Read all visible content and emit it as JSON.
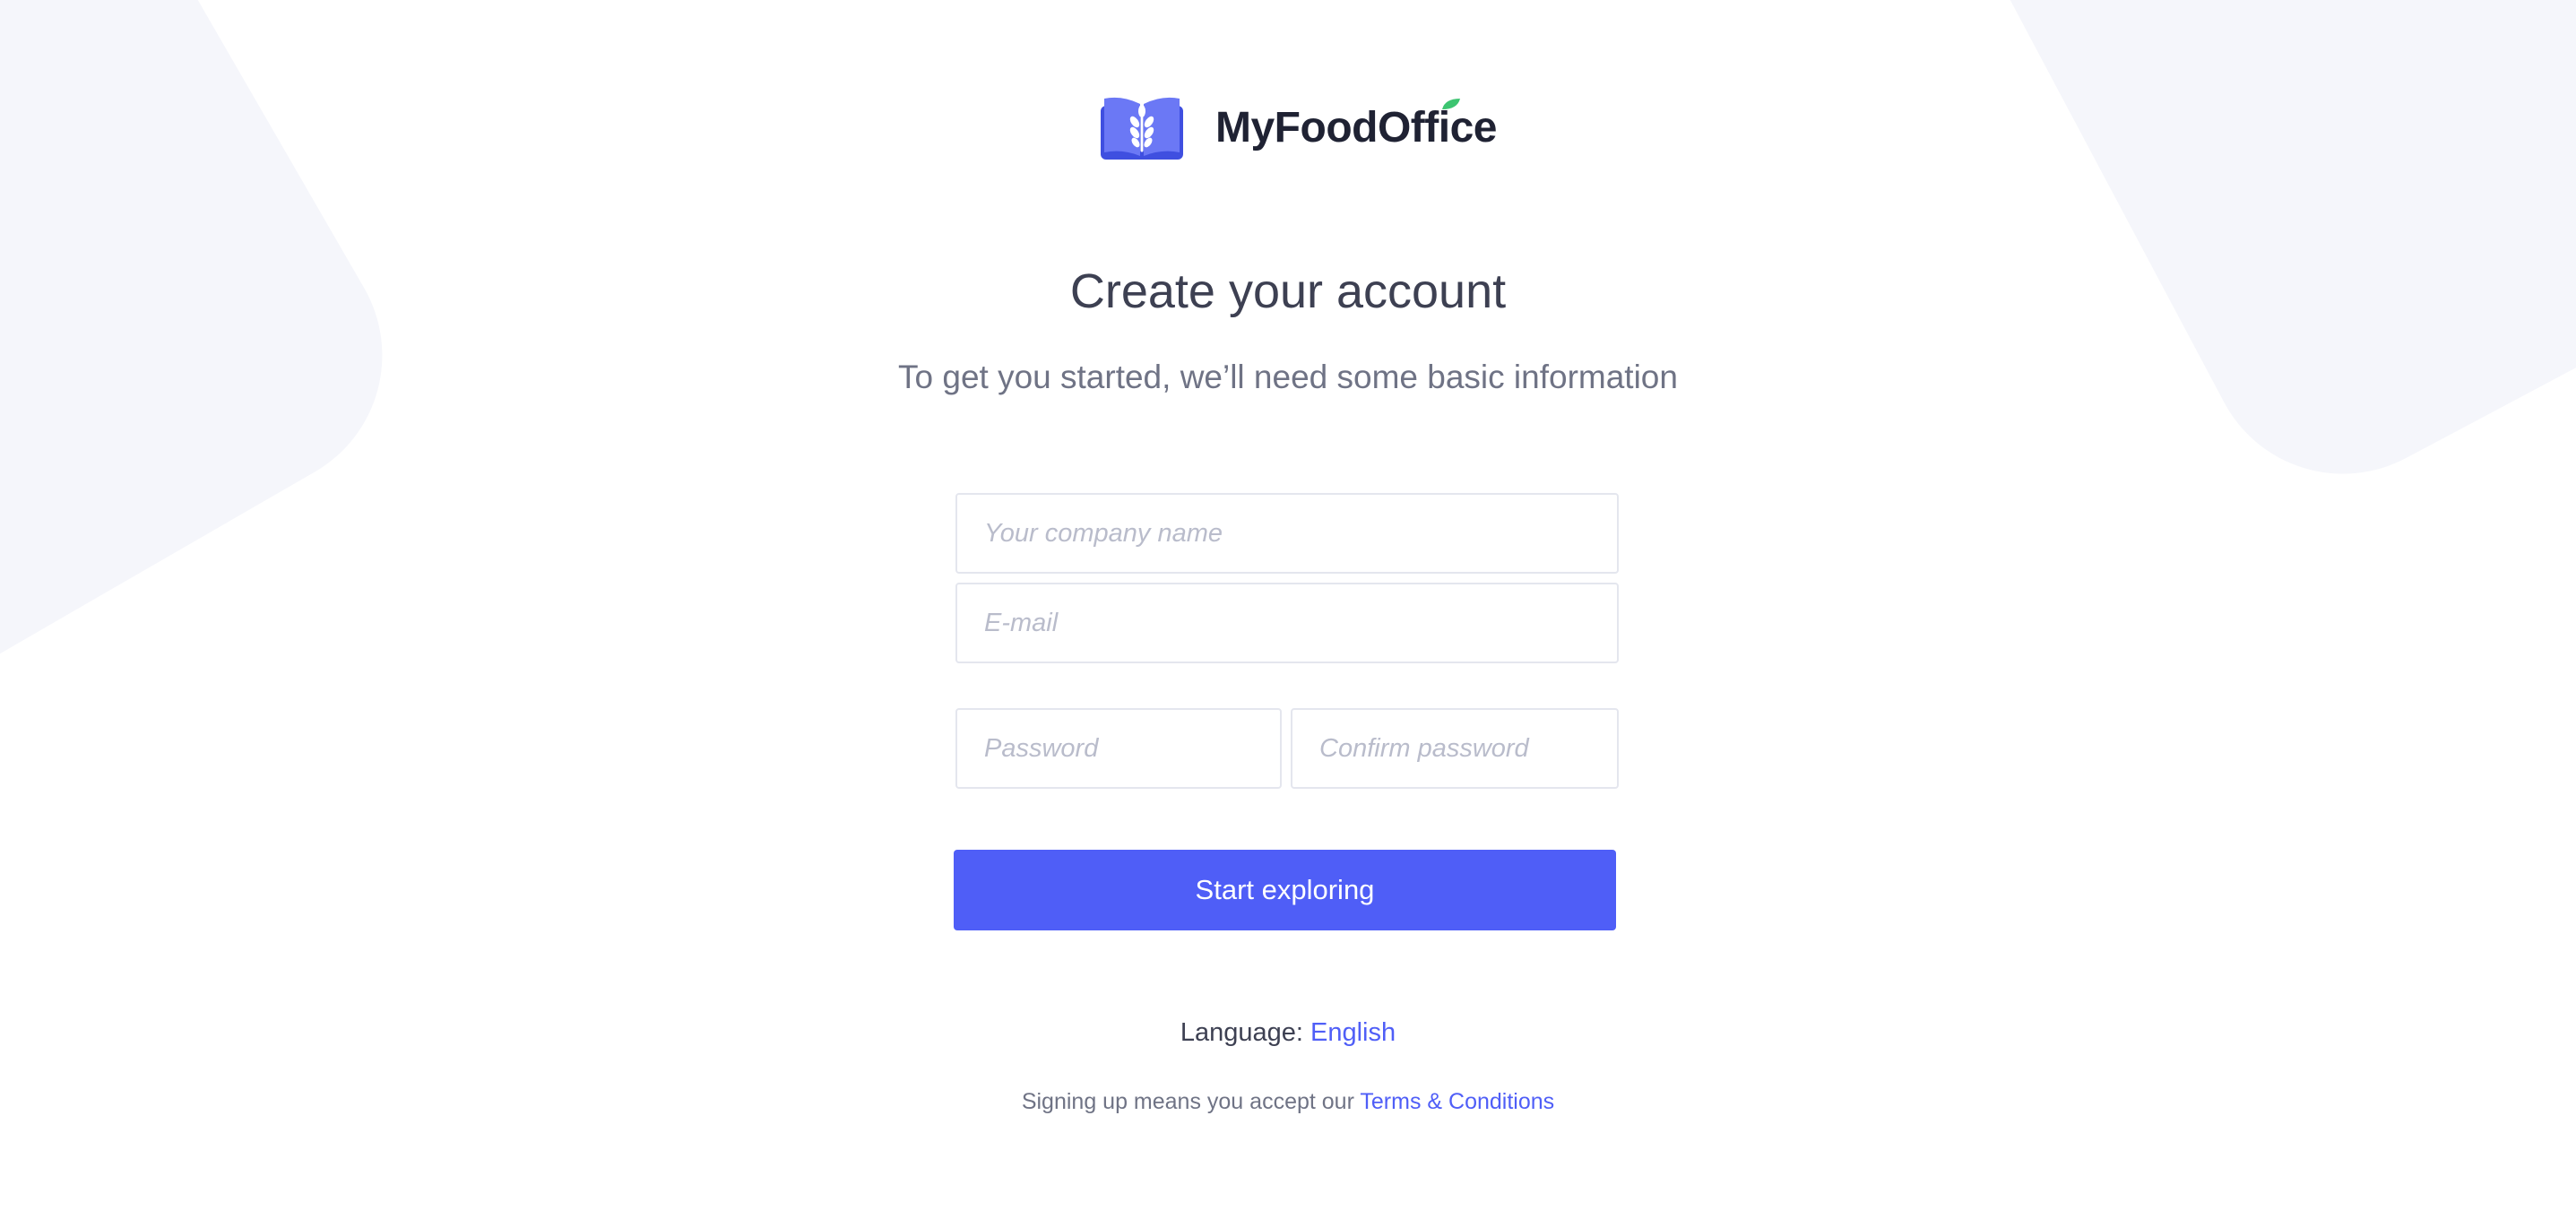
{
  "brand": {
    "name": "MyFoodOffice",
    "primary_color": "#4f5ef7",
    "leaf_color": "#3cc470"
  },
  "header": {
    "title": "Create your account",
    "subtitle": "To get you started, we’ll need some basic information"
  },
  "form": {
    "company_placeholder": "Your company name",
    "email_placeholder": "E-mail",
    "password_placeholder": "Password",
    "confirm_password_placeholder": "Confirm password",
    "submit_label": "Start exploring"
  },
  "footer": {
    "language_label": "Language:",
    "language_value": "English",
    "terms_prefix": "Signing up means you accept our",
    "terms_link": "Terms & Conditions"
  }
}
